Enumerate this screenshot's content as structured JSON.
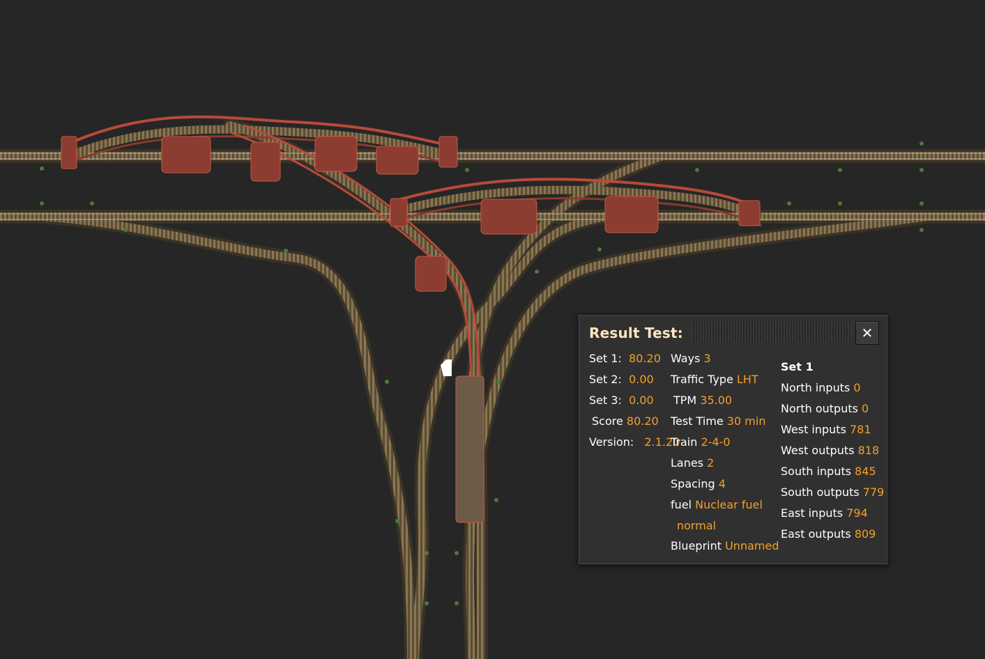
{
  "panel": {
    "title": "Result Test:",
    "test_number": "1",
    "close_icon": "close-icon",
    "sets": [
      {
        "label": "Set 1:",
        "value": "80.20"
      },
      {
        "label": "Set 2:",
        "value": "0.00"
      },
      {
        "label": "Set 3:",
        "value": "0.00"
      }
    ],
    "score": {
      "label": "Score",
      "value": "80.20"
    },
    "version": {
      "label": "Version:",
      "value": "2.1.20"
    },
    "settings": {
      "ways": {
        "label": "Ways",
        "value": "3"
      },
      "traffic": {
        "label": "Traffic Type",
        "value": "LHT"
      },
      "tpm": {
        "label": "TPM",
        "value": "35.00"
      },
      "test_time": {
        "label": "Test Time",
        "value": "30 min"
      },
      "train": {
        "label": "Train",
        "value": "2-4-0"
      },
      "lanes": {
        "label": "Lanes",
        "value": "2"
      },
      "spacing": {
        "label": "Spacing",
        "value": "4"
      },
      "fuel": {
        "label": "fuel",
        "value": "Nuclear fuel",
        "quality": "normal"
      },
      "blueprint": {
        "label": "Blueprint",
        "value": "Unnamed"
      }
    },
    "set_detail": {
      "heading": "Set 1",
      "rows": [
        {
          "label": "North inputs",
          "value": "0"
        },
        {
          "label": "North outputs",
          "value": "0"
        },
        {
          "label": "West inputs",
          "value": "781"
        },
        {
          "label": "West outputs",
          "value": "818"
        },
        {
          "label": "South inputs",
          "value": "845"
        },
        {
          "label": "South outputs",
          "value": "779"
        },
        {
          "label": "East inputs",
          "value": "794"
        },
        {
          "label": "East outputs",
          "value": "809"
        }
      ]
    }
  },
  "colors": {
    "background": "#262626",
    "panel": "#313031",
    "value": "#f2a02c",
    "title": "#ffe6c0",
    "rail": "#7a6a4a",
    "bridge": "#b84a3a"
  }
}
